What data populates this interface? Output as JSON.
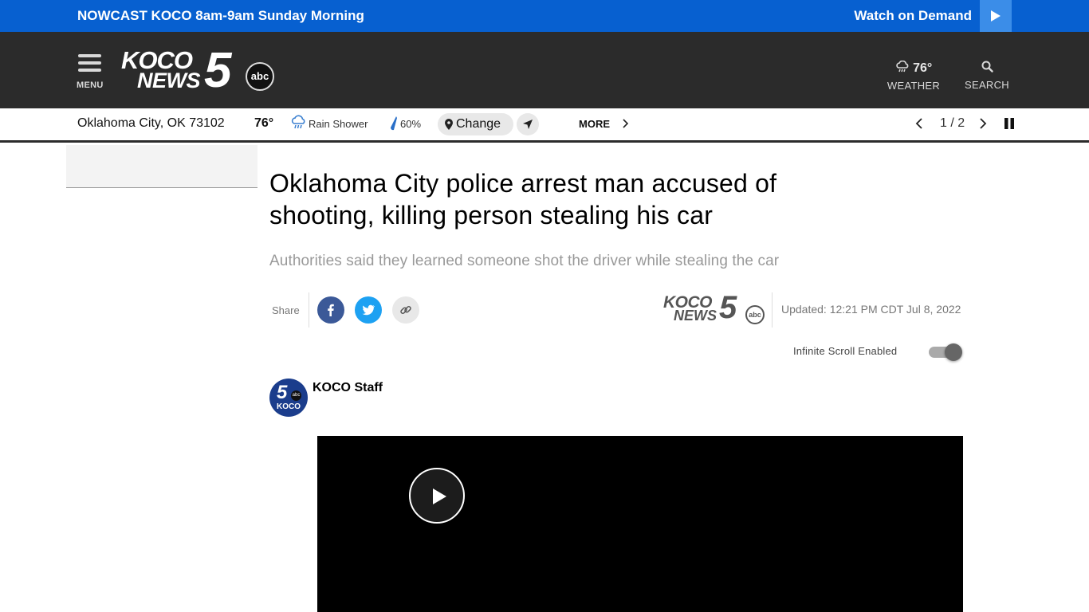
{
  "promo": {
    "nowcast": "NOWCAST KOCO 8am-9am Sunday Morning",
    "watch_on_demand": "Watch on Demand",
    "play_icon": "play-icon"
  },
  "header": {
    "menu_label": "MENU",
    "logo": {
      "koco": "KOCO",
      "news": "NEWS",
      "five": "5",
      "abc": "abc"
    },
    "weather_temp": "76°",
    "weather_label": "WEATHER",
    "search_label": "SEARCH"
  },
  "weather_strip": {
    "location": "Oklahoma City, OK 73102",
    "temp": "76°",
    "condition": "Rain Shower",
    "rain_chance": "60%",
    "change_label": "Change",
    "more_label": "MORE",
    "pager": "1 / 2"
  },
  "article": {
    "headline": "Oklahoma City police arrest man accused of shooting, killing person stealing his car",
    "subhead": "Authorities said they learned someone shot the driver while stealing the car",
    "share_label": "Share",
    "updated": "Updated: 12:21 PM CDT Jul 8, 2022",
    "infinite_scroll_label": "Infinite Scroll Enabled",
    "infinite_scroll_on": true,
    "author": "KOCO Staff",
    "avatar": {
      "five": "5",
      "abc": "abc",
      "koco": "KOCO"
    }
  },
  "colors": {
    "promo_bg": "#0760d0",
    "header_bg": "#2b2b2b",
    "facebook": "#3b5998",
    "twitter": "#1da1f2"
  }
}
